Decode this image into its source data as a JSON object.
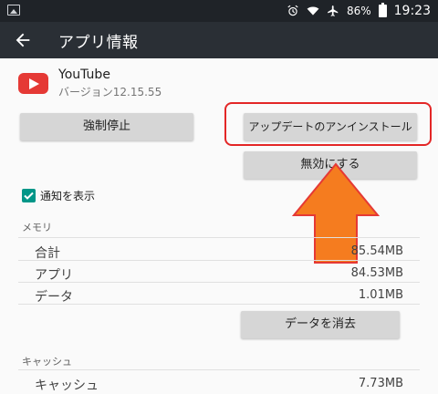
{
  "status_bar": {
    "battery": "86%",
    "time": "19:23"
  },
  "app_bar": {
    "title": "アプリ情報"
  },
  "app": {
    "name": "YouTube",
    "version": "バージョン12.15.55"
  },
  "buttons": {
    "force_stop": "強制停止",
    "uninstall_updates": "アップデートのアンインストール",
    "disable": "無効にする",
    "clear_data": "データを消去"
  },
  "notifications": {
    "label": "通知を表示",
    "checked": true
  },
  "memory": {
    "header": "メモリ",
    "rows": [
      {
        "label": "合計",
        "value": "85.54MB"
      },
      {
        "label": "アプリ",
        "value": "84.53MB"
      },
      {
        "label": "データ",
        "value": "1.01MB"
      }
    ]
  },
  "cache": {
    "header": "キャッシュ",
    "rows": [
      {
        "label": "キャッシュ",
        "value": "7.73MB"
      }
    ]
  },
  "colors": {
    "accent": "#009688",
    "highlight": "#e32626",
    "arrow": "#f57c1f"
  }
}
